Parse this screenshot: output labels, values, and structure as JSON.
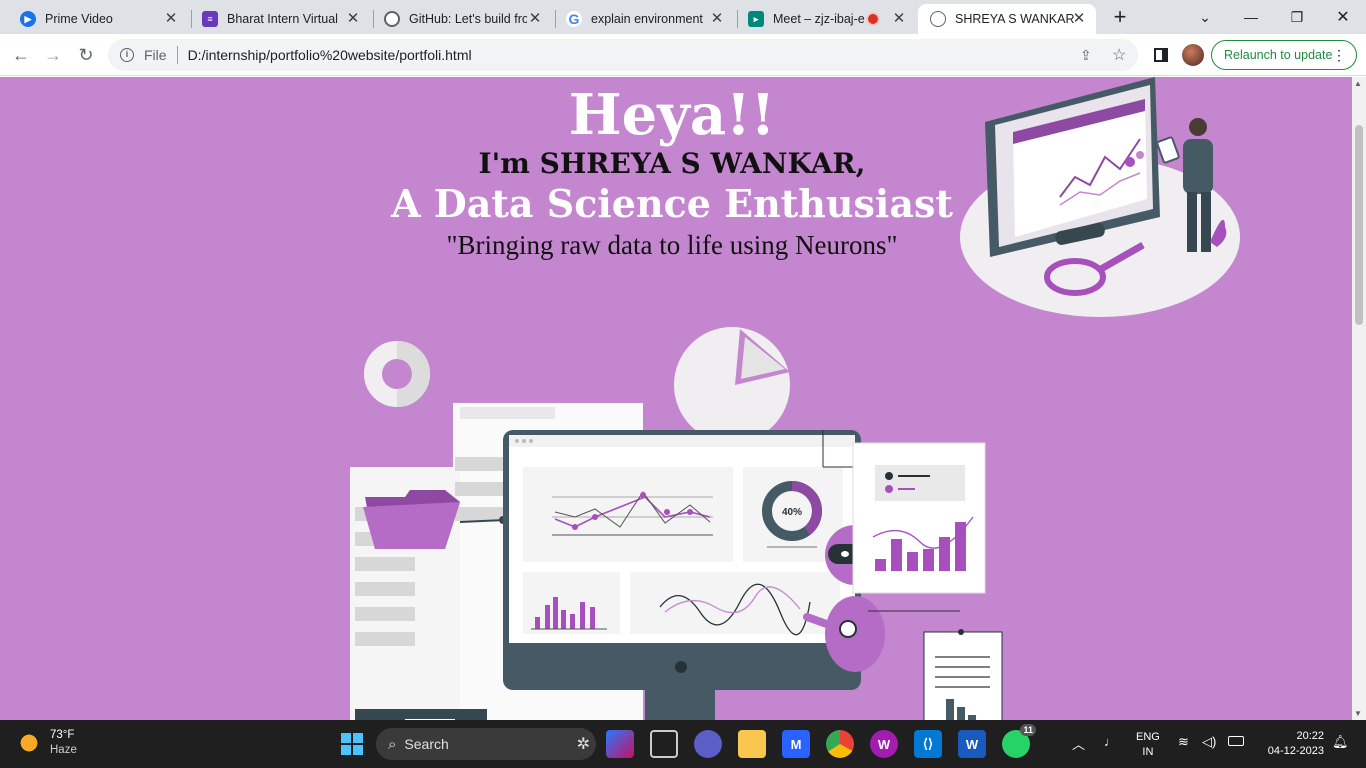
{
  "browser": {
    "tabs": [
      {
        "title": "Prime Video",
        "icon": "prime-video-icon",
        "color": "#1a73e8"
      },
      {
        "title": "Bharat Intern Virtual I",
        "icon": "forms-icon",
        "color": "#673ab7"
      },
      {
        "title": "GitHub: Let's build fro",
        "icon": "github-icon",
        "color": "#24292f"
      },
      {
        "title": "explain environmenta",
        "icon": "google-icon",
        "color": "#4285f4"
      },
      {
        "title": "Meet – zjz-ibaj-er",
        "icon": "meet-icon",
        "color": "#00897b"
      },
      {
        "title": "SHREYA S WANKAR",
        "icon": "globe-icon",
        "color": "#5f6368"
      }
    ],
    "address": {
      "scheme_label": "File",
      "url": "D:/internship/portfolio%20website/portfoli.html"
    },
    "relaunch_label": "Relaunch to update"
  },
  "page": {
    "greeting": "Heya!!",
    "intro": "I'm SHREYA S WANKAR,",
    "role": "A Data Science Enthusiast",
    "tagline": "\"Bringing raw data to life using Neurons\"",
    "donut_label": "40%",
    "colors": {
      "background": "#c586d0",
      "accent": "#a64fbd",
      "dark": "#455a64"
    }
  },
  "taskbar": {
    "weather": {
      "temp": "73°F",
      "condition": "Haze"
    },
    "search_label": "Search",
    "language": {
      "line1": "ENG",
      "line2": "IN"
    },
    "clock": {
      "time": "20:22",
      "date": "04-12-2023"
    },
    "whatsapp_badge": "11"
  }
}
